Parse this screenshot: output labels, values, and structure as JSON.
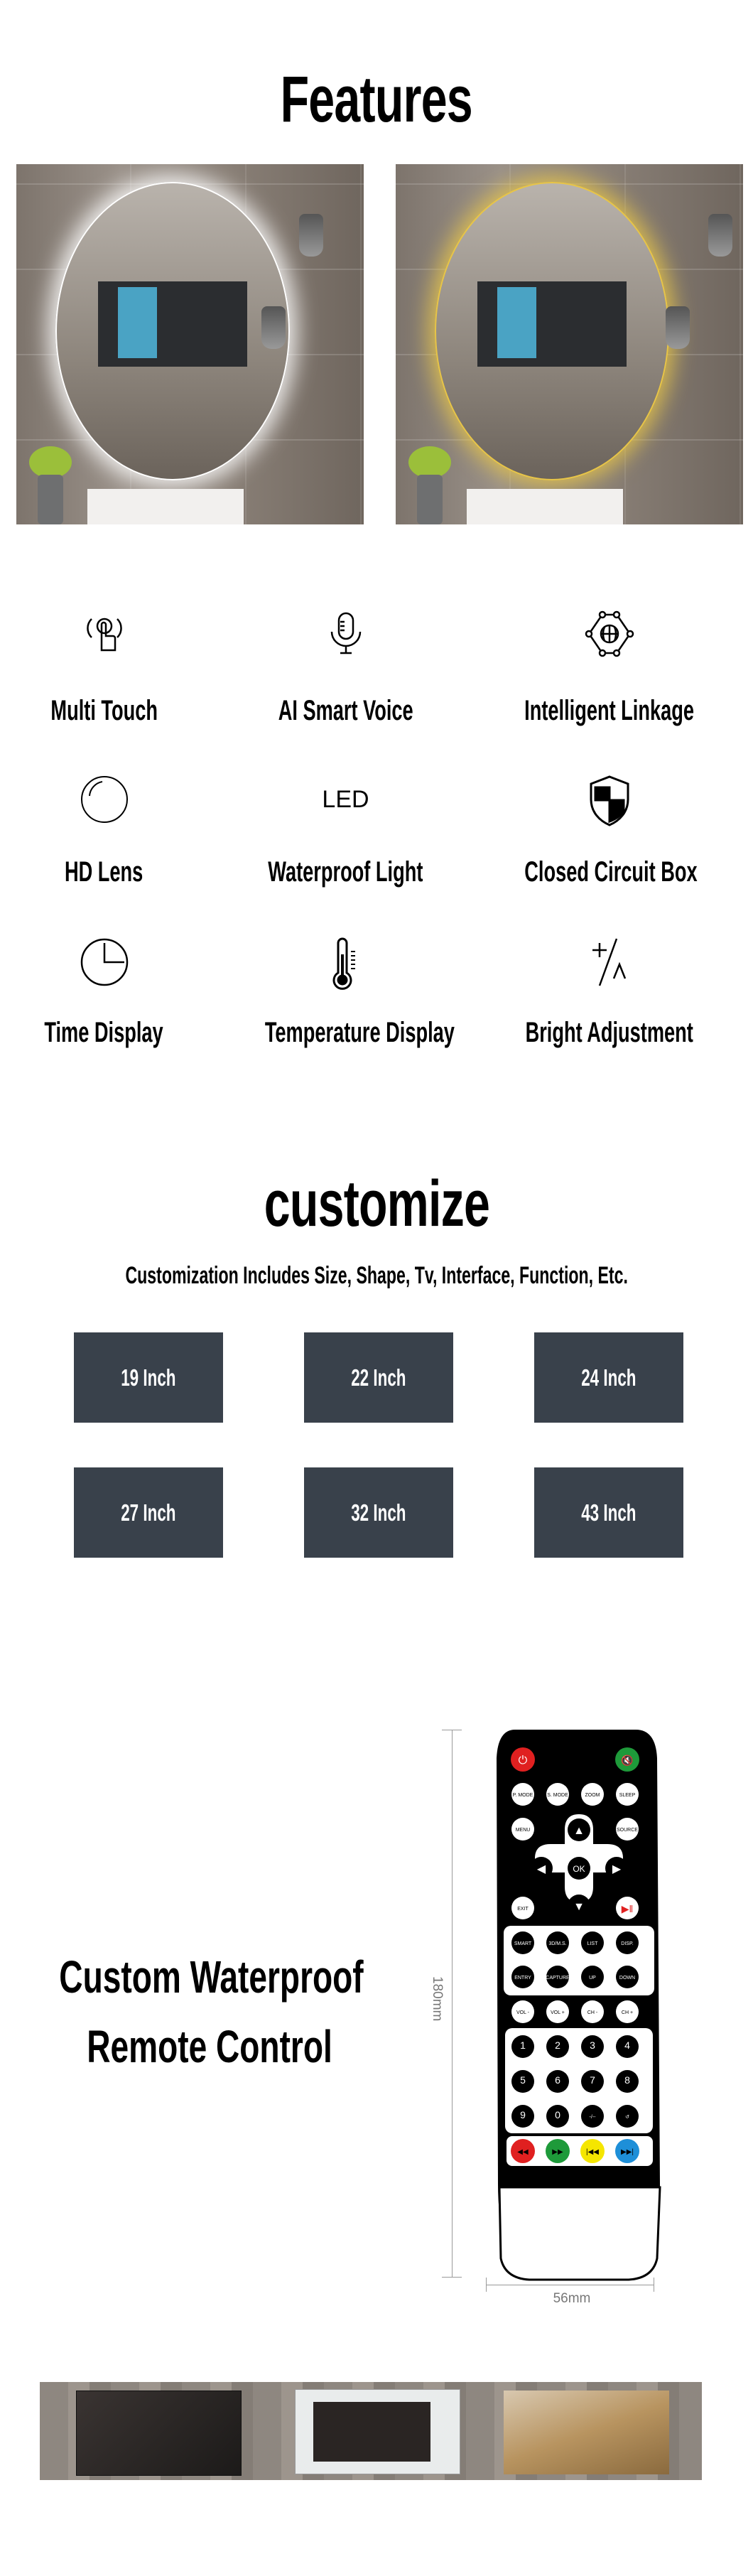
{
  "features_section": {
    "title": "Features",
    "items": [
      {
        "label": "Multi Touch",
        "icon": "multi-touch-icon"
      },
      {
        "label": "AI Smart Voice",
        "icon": "microphone-icon"
      },
      {
        "label": "Intelligent Linkage",
        "icon": "globe-network-icon"
      },
      {
        "label": "HD Lens",
        "icon": "lens-circle-icon"
      },
      {
        "label": "Waterproof Light",
        "icon": "led-icon",
        "icon_text": "LED"
      },
      {
        "label": "Closed Circuit Box",
        "icon": "shield-icon"
      },
      {
        "label": "Time Display",
        "icon": "clock-icon"
      },
      {
        "label": "Temperature Display",
        "icon": "thermometer-icon"
      },
      {
        "label": "Bright Adjustment",
        "icon": "plus-minus-icon"
      }
    ],
    "glow_colors": {
      "white": "#ffffff",
      "warm": "#e8c547"
    }
  },
  "customize_section": {
    "title": "customize",
    "subtitle": "Customization Includes Size, Shape, Tv, Interface, Function, Etc.",
    "sizes": [
      "19 Inch",
      "22 Inch",
      "24 Inch",
      "27 Inch",
      "32 Inch",
      "43 Inch"
    ],
    "box_color": "#39414b"
  },
  "remote_section": {
    "title_line1": "Custom Waterproof",
    "title_line2": "Remote Control",
    "height_label": "180mm",
    "width_label": "56mm",
    "rows": [
      [
        "P. MODE",
        "S. MODE",
        "ZOOM",
        "SLEEP"
      ],
      [
        "MENU",
        "SOURCE"
      ],
      [
        "OK"
      ],
      [
        "EXIT"
      ],
      [
        "SMART",
        "3D/M.S.",
        "LIST",
        "DISP."
      ],
      [
        "ENTRY",
        "CAPTURE",
        "UP",
        "DOWN"
      ],
      [
        "VOL -",
        "VOL +",
        "CH -",
        "CH +"
      ],
      [
        "1",
        "2",
        "3",
        "4"
      ],
      [
        "5",
        "6",
        "7",
        "8"
      ],
      [
        "9",
        "0",
        "-/--",
        "↺"
      ]
    ],
    "color_buttons": [
      "#e02020",
      "#1e9a3a",
      "#f5e600",
      "#1e8fd8"
    ],
    "power_color": "#e02020",
    "mute_color": "#1e9a3a"
  }
}
